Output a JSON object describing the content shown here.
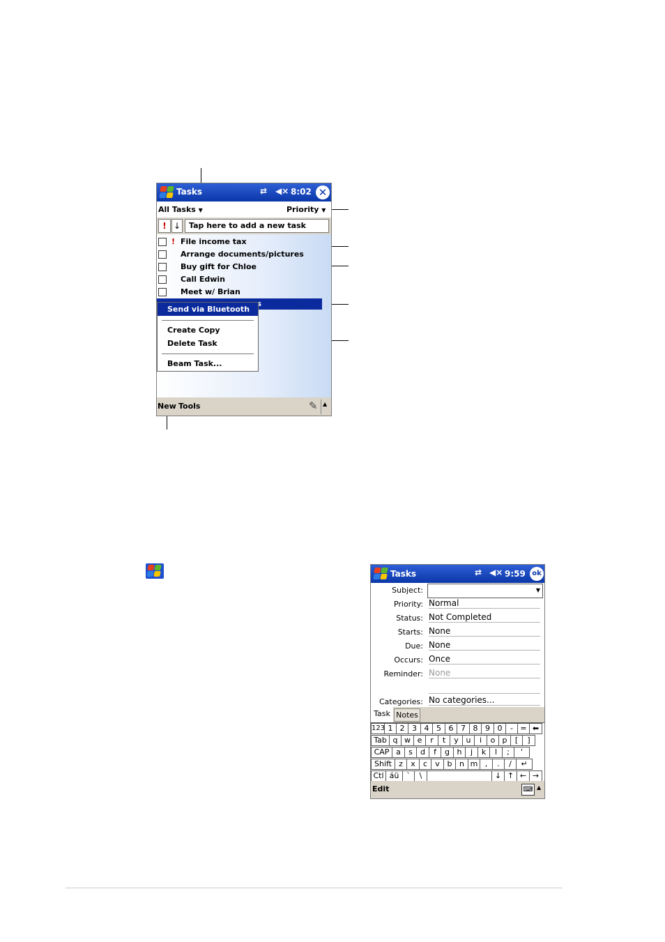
{
  "screen1": {
    "title": "Tasks",
    "time": "8:02",
    "close_glyph": "✕",
    "filter": "All Tasks",
    "sort": "Priority",
    "entry_priority": "!",
    "entry_sort": "↓",
    "entry_placeholder": "Tap here to add a new task",
    "tasks": [
      {
        "label": "File income tax",
        "priority": "!"
      },
      {
        "label": "Arrange documents/pictures"
      },
      {
        "label": "Buy gift for Chloe"
      },
      {
        "label": "Call Edwin"
      },
      {
        "label": "Meet w/ Brian"
      },
      {
        "label": "es"
      }
    ],
    "menu": {
      "items": [
        "Send via Bluetooth",
        "Create Copy",
        "Delete Task",
        "Beam Task..."
      ]
    },
    "bottom": {
      "new": "New",
      "tools": "Tools"
    }
  },
  "screen2": {
    "title": "Tasks",
    "time": "9:59",
    "ok": "ok",
    "fields": [
      {
        "label": "Subject:",
        "value": ""
      },
      {
        "label": "Priority:",
        "value": "Normal"
      },
      {
        "label": "Status:",
        "value": "Not Completed"
      },
      {
        "label": "Starts:",
        "value": "None"
      },
      {
        "label": "Due:",
        "value": "None"
      },
      {
        "label": "Occurs:",
        "value": "Once"
      },
      {
        "label": "Reminder:",
        "value": "None"
      },
      {
        "label": "Categories:",
        "value": "No categories..."
      }
    ],
    "tabs": [
      "Task",
      "Notes"
    ],
    "keyboard": {
      "row1": [
        "123",
        "1",
        "2",
        "3",
        "4",
        "5",
        "6",
        "7",
        "8",
        "9",
        "0",
        "-",
        "=",
        "⬅"
      ],
      "row2": [
        "Tab",
        "q",
        "w",
        "e",
        "r",
        "t",
        "y",
        "u",
        "i",
        "o",
        "p",
        "[",
        "]"
      ],
      "row3": [
        "CAP",
        "a",
        "s",
        "d",
        "f",
        "g",
        "h",
        "j",
        "k",
        "l",
        ";",
        "'"
      ],
      "row4": [
        "Shift",
        "z",
        "x",
        "c",
        "v",
        "b",
        "n",
        "m",
        ",",
        ".",
        "/",
        "↵"
      ],
      "row5": [
        "Ctl",
        "áü",
        "`",
        "\\",
        "↓",
        "↑",
        "←",
        "→"
      ]
    },
    "bottom": {
      "edit": "Edit"
    }
  },
  "colors": {
    "titlebar": "#0a37a8",
    "selection": "#0a2a9e",
    "toolbar": "#d9d4c7",
    "priority_mark": "#cc0000"
  }
}
